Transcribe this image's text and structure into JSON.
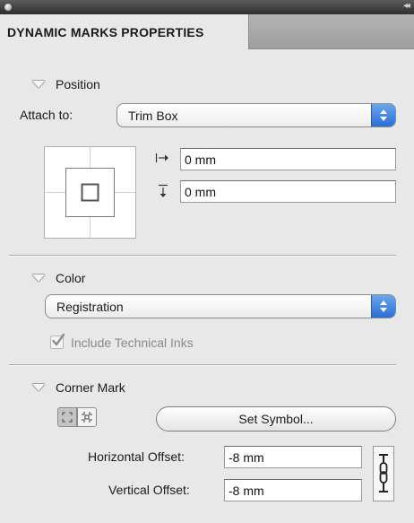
{
  "panel": {
    "tab_title": "DYNAMIC MARKS PROPERTIES",
    "collapse_glyph": "◂◂"
  },
  "position": {
    "header": "Position",
    "attach_label": "Attach to:",
    "attach_value": "Trim Box",
    "x_offset": "0 mm",
    "y_offset": "0 mm"
  },
  "color": {
    "header": "Color",
    "value": "Registration",
    "include_inks_label": "Include Technical Inks",
    "include_inks_checked": true
  },
  "corner_mark": {
    "header": "Corner Mark",
    "set_symbol_label": "Set Symbol...",
    "h_offset_label": "Horizontal Offset:",
    "h_offset_value": "-8 mm",
    "v_offset_label": "Vertical Offset:",
    "v_offset_value": "-8 mm"
  },
  "colors": {
    "accent": "#2a6ed6",
    "panel_bg": "#e8e8e8"
  },
  "icons": [
    "close-icon",
    "collapse-icon",
    "disclosure-triangle-icon",
    "x-offset-icon",
    "y-offset-icon",
    "popup-arrows-icon",
    "checkbox-check-icon",
    "corner-mark-style-icon",
    "link-chain-icon"
  ]
}
